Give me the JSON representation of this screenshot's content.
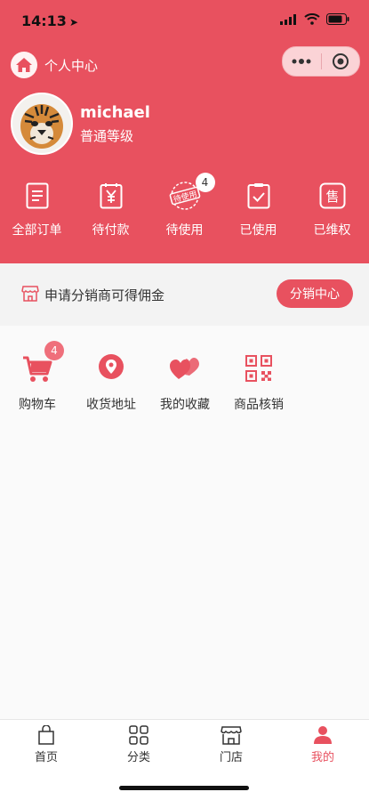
{
  "status_bar": {
    "time": "14:13",
    "location_glyph": "➤"
  },
  "navbar": {
    "title": "个人中心"
  },
  "profile": {
    "username": "michael",
    "level": "普通等级"
  },
  "orders": [
    {
      "label": "全部订单",
      "icon": "order-list-icon"
    },
    {
      "label": "待付款",
      "icon": "yen-document-icon"
    },
    {
      "label": "待使用",
      "icon": "to-use-stamp-icon",
      "stamp_text": "待使用",
      "badge": "4"
    },
    {
      "label": "已使用",
      "icon": "checked-clipboard-icon"
    },
    {
      "label": "已维权",
      "icon": "after-sale-icon",
      "glyph": "售"
    }
  ],
  "distributor": {
    "text": "申请分销商可得佣金",
    "button": "分销中心"
  },
  "services": [
    {
      "label": "购物车",
      "icon": "cart-icon",
      "badge": "4"
    },
    {
      "label": "收货地址",
      "icon": "location-pin-icon"
    },
    {
      "label": "我的收藏",
      "icon": "hearts-icon"
    },
    {
      "label": "商品核销",
      "icon": "qr-code-icon"
    }
  ],
  "tabbar": [
    {
      "label": "首页",
      "icon": "bag-icon"
    },
    {
      "label": "分类",
      "icon": "grid-icon"
    },
    {
      "label": "门店",
      "icon": "store-icon"
    },
    {
      "label": "我的",
      "icon": "user-icon",
      "active": true
    }
  ],
  "colors": {
    "brand": "#e8515f",
    "text": "#333333",
    "background": "#fafafa"
  }
}
